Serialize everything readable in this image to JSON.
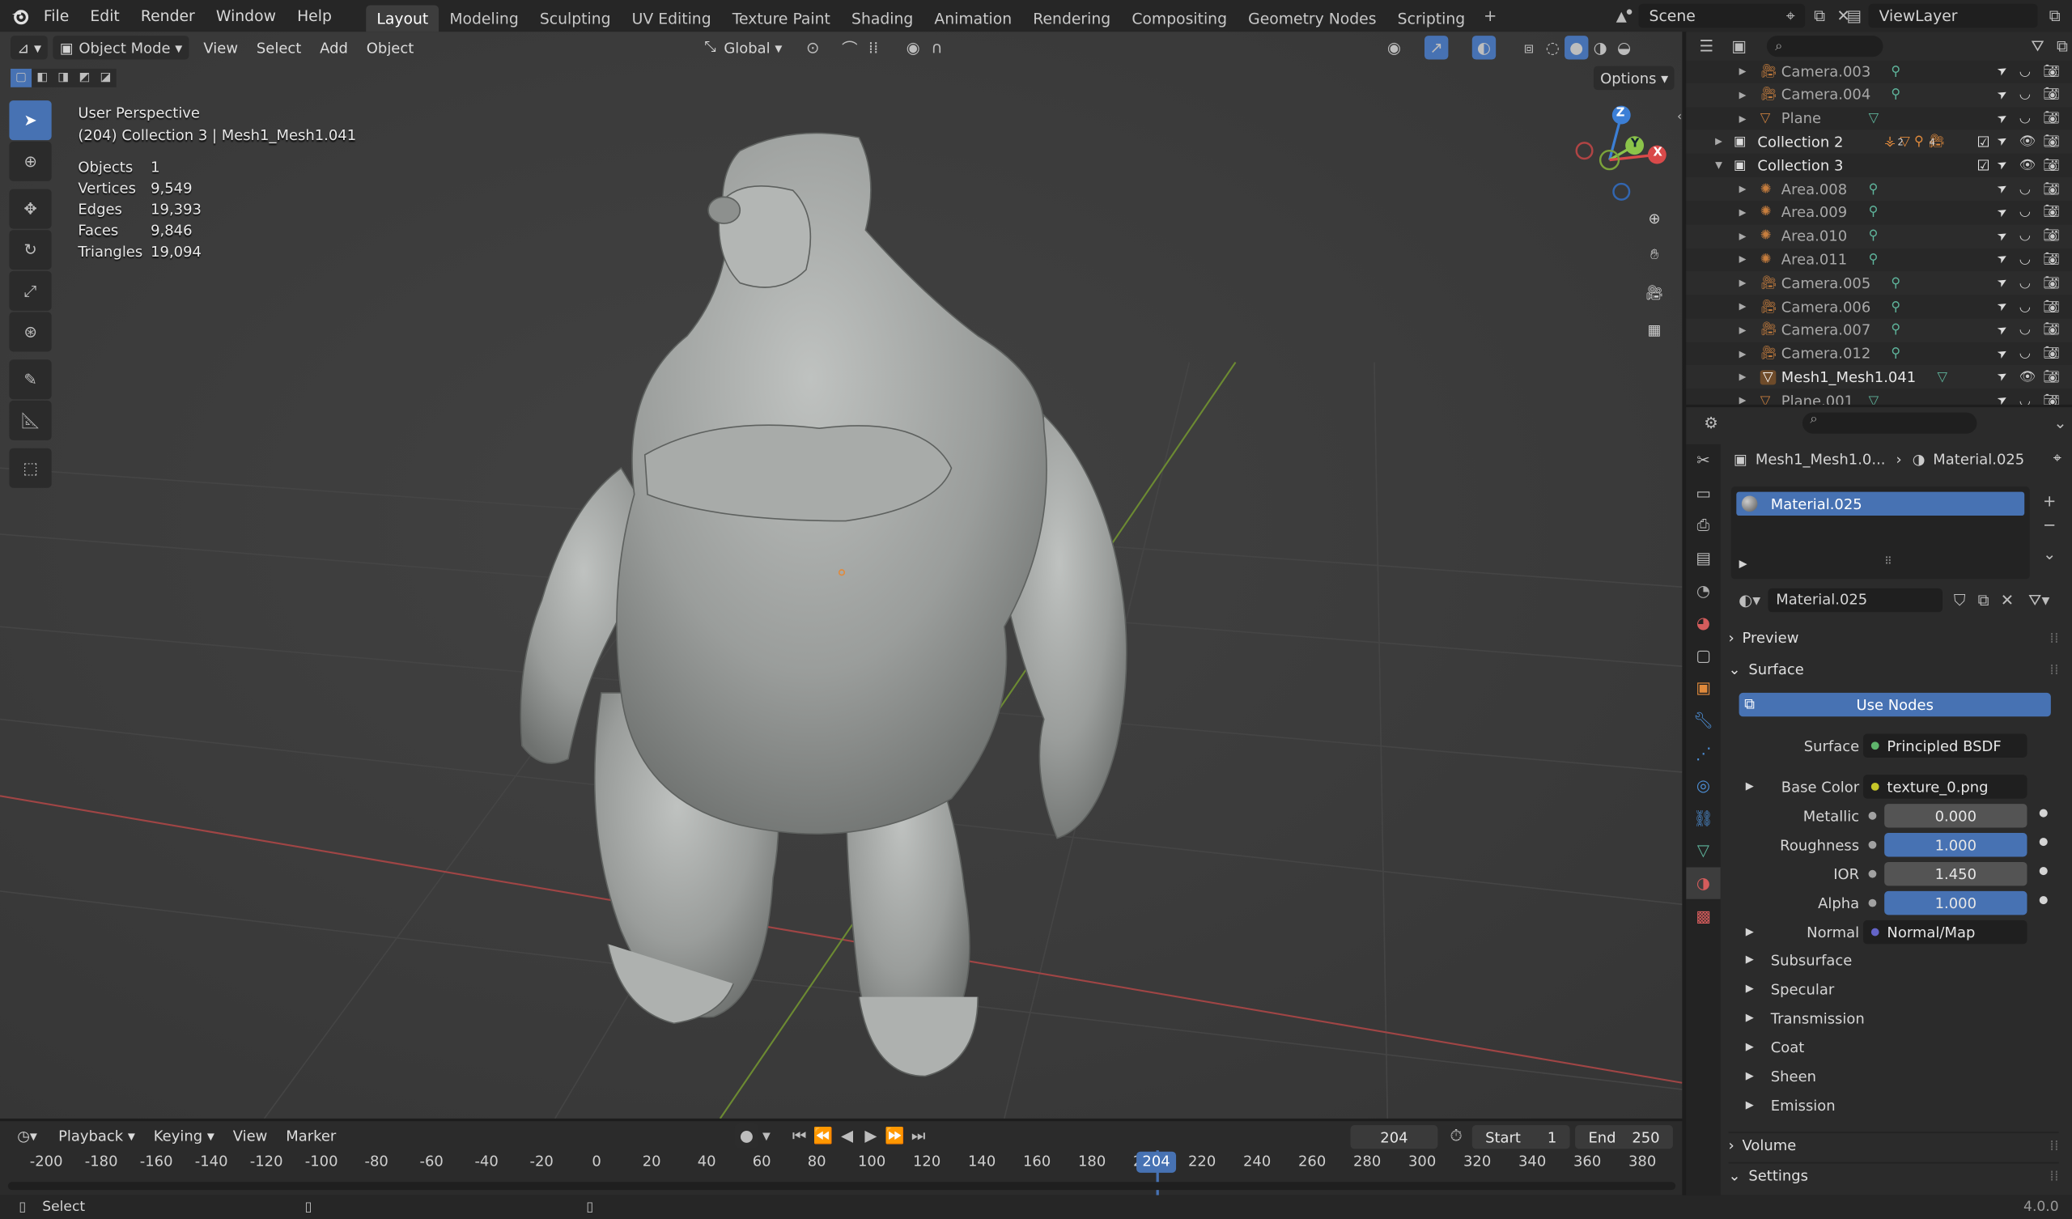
{
  "top_menu": [
    "File",
    "Edit",
    "Render",
    "Window",
    "Help"
  ],
  "workspaces": [
    "Layout",
    "Modeling",
    "Sculpting",
    "UV Editing",
    "Texture Paint",
    "Shading",
    "Animation",
    "Rendering",
    "Compositing",
    "Geometry Nodes",
    "Scripting"
  ],
  "active_workspace": "Layout",
  "scene": "Scene",
  "view_layer": "ViewLayer",
  "viewport": {
    "mode": "Object Mode",
    "menus": [
      "View",
      "Select",
      "Add",
      "Object"
    ],
    "transform_orientation": "Global",
    "options": "Options",
    "view_name": "User Perspective",
    "collection_info": "(204) Collection 3 | Mesh1_Mesh1.041",
    "stats": [
      [
        "Objects",
        "1"
      ],
      [
        "Vertices",
        "9,549"
      ],
      [
        "Edges",
        "19,393"
      ],
      [
        "Faces",
        "9,846"
      ],
      [
        "Triangles",
        "19,094"
      ]
    ],
    "gizmo": {
      "z": "Z",
      "y": "Y",
      "x": "X"
    }
  },
  "outliner": {
    "rows": [
      {
        "label": "Camera.003",
        "icon": "camera-icon",
        "indent": 2
      },
      {
        "label": "Camera.004",
        "icon": "camera-icon",
        "indent": 2
      },
      {
        "label": "Plane",
        "icon": "mesh-icon",
        "indent": 2
      },
      {
        "label": "Collection 2",
        "icon": "collection-icon",
        "indent": 1
      },
      {
        "label": "Collection 3",
        "icon": "collection-icon",
        "indent": 1
      },
      {
        "label": "Area.008",
        "icon": "light-icon",
        "indent": 2
      },
      {
        "label": "Area.009",
        "icon": "light-icon",
        "indent": 2
      },
      {
        "label": "Area.010",
        "icon": "light-icon",
        "indent": 2
      },
      {
        "label": "Area.011",
        "icon": "light-icon",
        "indent": 2
      },
      {
        "label": "Camera.005",
        "icon": "camera-icon",
        "indent": 2
      },
      {
        "label": "Camera.006",
        "icon": "camera-icon",
        "indent": 2
      },
      {
        "label": "Camera.007",
        "icon": "camera-icon",
        "indent": 2
      },
      {
        "label": "Camera.012",
        "icon": "camera-icon",
        "indent": 2
      },
      {
        "label": "Mesh1_Mesh1.041",
        "icon": "mesh-icon",
        "indent": 2
      },
      {
        "label": "Plane.001",
        "icon": "mesh-icon",
        "indent": 2
      }
    ],
    "collection2_counts": {
      "a": "2",
      "b": "4"
    }
  },
  "properties": {
    "breadcrumb_object": "Mesh1_Mesh1.0...",
    "breadcrumb_material": "Material.025",
    "slot_name": "Material.025",
    "material_name": "Material.025",
    "panels": {
      "preview": "Preview",
      "surface": "Surface",
      "volume": "Volume",
      "settings": "Settings"
    },
    "use_nodes": "Use Nodes",
    "surface_label": "Surface",
    "surface_value": "Principled BSDF",
    "base_color_label": "Base Color",
    "base_color_value": "texture_0.png",
    "metallic_label": "Metallic",
    "metallic": "0.000",
    "roughness_label": "Roughness",
    "roughness": "1.000",
    "ior_label": "IOR",
    "ior": "1.450",
    "alpha_label": "Alpha",
    "alpha": "1.000",
    "normal_label": "Normal",
    "normal_value": "Normal/Map",
    "subpanels": [
      "Subsurface",
      "Specular",
      "Transmission",
      "Coat",
      "Sheen",
      "Emission"
    ]
  },
  "timeline": {
    "menus": [
      "Playback",
      "Keying",
      "View",
      "Marker"
    ],
    "current_frame": "204",
    "start_label": "Start",
    "start": "1",
    "end_label": "End",
    "end": "250",
    "ticks": [
      "-200",
      "-180",
      "-160",
      "-140",
      "-120",
      "-100",
      "-80",
      "-60",
      "-40",
      "-20",
      "0",
      "20",
      "40",
      "60",
      "80",
      "100",
      "120",
      "140",
      "160",
      "180",
      "200",
      "220",
      "240",
      "260",
      "280",
      "300",
      "320",
      "340",
      "360",
      "380"
    ]
  },
  "status": {
    "left": "Select",
    "version": "4.0.0"
  },
  "colors": {
    "accent": "#4772b3",
    "orange": "#e08a3c",
    "green_icon": "#5fb59c",
    "axis_x": "#d94a4a",
    "axis_y": "#8bc34a",
    "axis_z": "#3c7fd6"
  }
}
